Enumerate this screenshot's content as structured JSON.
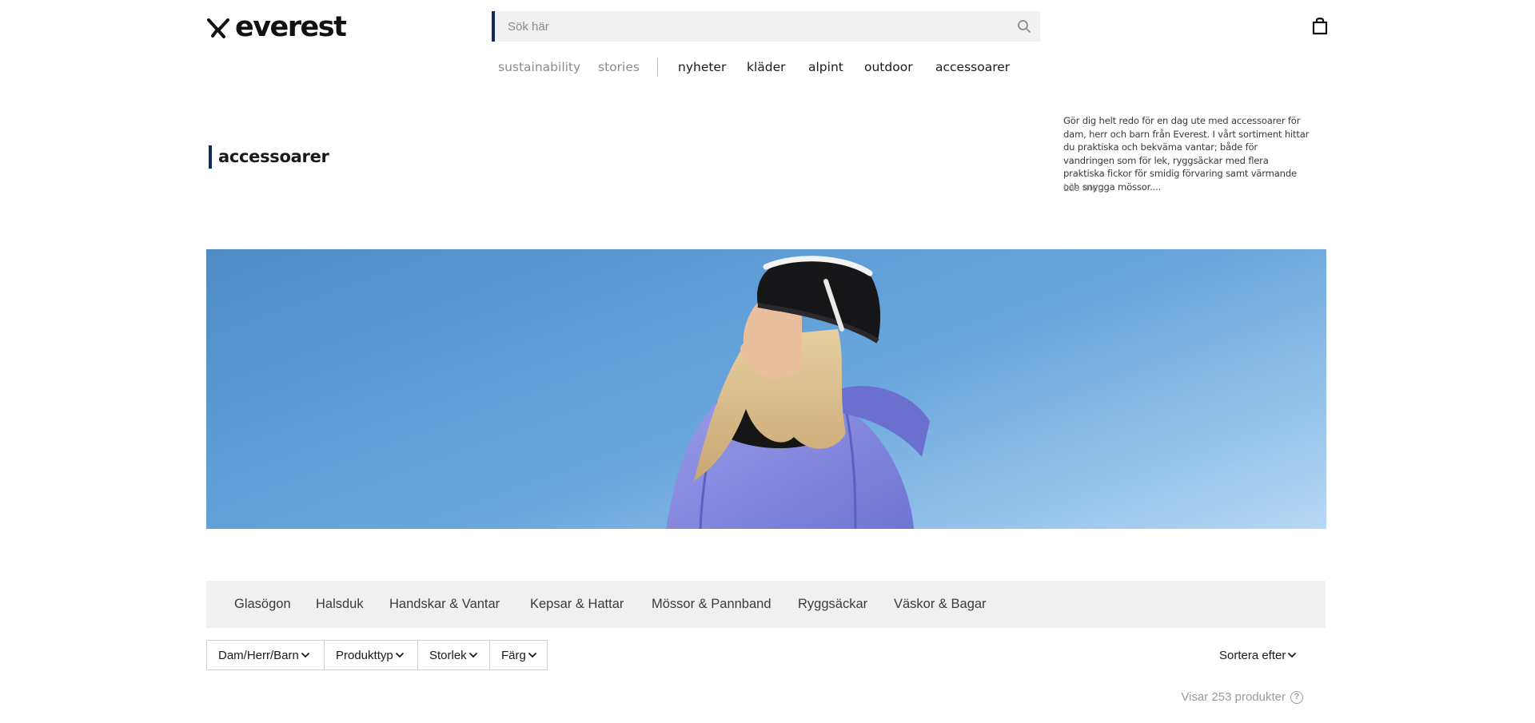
{
  "header": {
    "logo_text": "everest",
    "search": {
      "placeholder": "Sök här",
      "value": ""
    },
    "icons": {
      "search": "search-icon",
      "bag": "shopping-bag-icon",
      "logo_mark": "everest-x-mark-icon"
    }
  },
  "nav": {
    "secondary": [
      "sustainability",
      "stories"
    ],
    "primary": [
      "nyheter",
      "kläder",
      "alpint",
      "outdoor",
      "accessoarer"
    ]
  },
  "category": {
    "title": "accessoarer",
    "description": "Gör dig helt redo för en dag ute med accessoarer för dam, herr och barn från Everest. I vårt sortiment hittar du praktiska och bekväma vantar; både för vandringen som för lek, ryggsäckar med flera praktiska fickor för smidig förvaring samt värmande och snygga mössor....",
    "read_more": "Läs mer"
  },
  "hero": {
    "image": "woman-in-black-beanie-and-lilac-ski-jacket-against-blue-sky"
  },
  "subcategories": [
    "Glasögon",
    "Halsduk",
    "Handskar & Vantar",
    "Kepsar & Hattar",
    "Mössor & Pannband",
    "Ryggsäckar",
    "Väskor & Bagar"
  ],
  "filters": [
    "Dam/Herr/Barn",
    "Produkttyp",
    "Storlek",
    "Färg"
  ],
  "sort": {
    "label": "Sortera efter"
  },
  "results": {
    "count_text": "Visar 253 produkter",
    "help_glyph": "?"
  },
  "colors": {
    "accent": "#0f2a5c",
    "subcat_bg": "#f0f0f0",
    "muted_text": "#8c8c8c"
  }
}
